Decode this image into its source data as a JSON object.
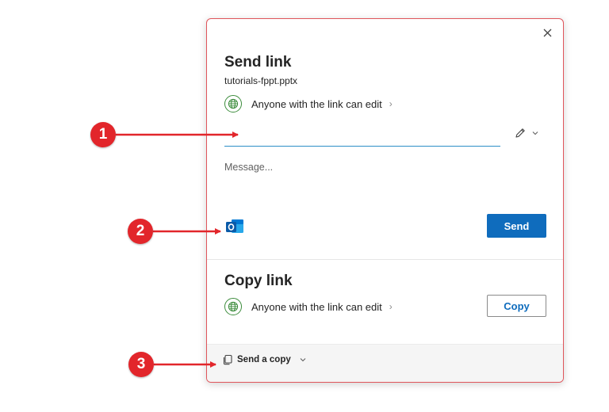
{
  "dialog": {
    "send_section": {
      "title": "Send link",
      "file_name": "tutorials-fppt.pptx",
      "permission_text": "Anyone with the link can edit",
      "recipient_value": "",
      "message_placeholder": "Message...",
      "send_label": "Send"
    },
    "copy_section": {
      "title": "Copy link",
      "permission_text": "Anyone with the link can edit",
      "copy_label": "Copy"
    },
    "footer": {
      "send_copy_label": "Send a copy"
    },
    "icons": {
      "close": "close-icon",
      "globe": "globe-icon",
      "pencil": "pencil-icon",
      "outlook": "outlook-icon",
      "copy_pages": "copy-icon"
    }
  },
  "annotations": {
    "markers": [
      {
        "label": "1"
      },
      {
        "label": "2"
      },
      {
        "label": "3"
      }
    ]
  },
  "colors": {
    "accent": "#0f6cbd",
    "border": "#e0555b",
    "marker": "#e2262b",
    "globe": "#3c8c3c",
    "input_underline": "#2d8fc7"
  }
}
